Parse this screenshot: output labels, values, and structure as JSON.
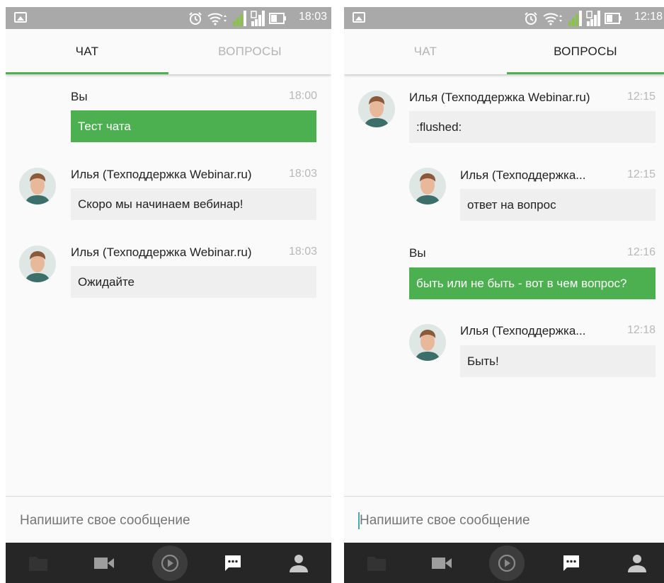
{
  "colors": {
    "accent": "#4caf50",
    "statusbar": "#a9a9a9",
    "navbar": "#262626",
    "bubble_other": "#efefef"
  },
  "left": {
    "status_time": "18:03",
    "tabs": [
      {
        "label": "ЧАТ",
        "active": true
      },
      {
        "label": "ВОПРОСЫ",
        "active": false
      }
    ],
    "messages": [
      {
        "sender": "Вы",
        "time": "18:00",
        "text": "Тест чата",
        "own": true
      },
      {
        "sender": "Илья (Техподдержка Webinar.ru)",
        "time": "18:03",
        "text": "Скоро мы начинаем вебинар!",
        "own": false
      },
      {
        "sender": "Илья (Техподдержка Webinar.ru)",
        "time": "18:03",
        "text": "Ожидайте",
        "own": false
      }
    ],
    "input_placeholder": "Напишите свое сообщение"
  },
  "right": {
    "status_time": "12:18",
    "tabs": [
      {
        "label": "ЧАТ",
        "active": false
      },
      {
        "label": "ВОПРОСЫ",
        "active": true
      }
    ],
    "messages": [
      {
        "sender": "Илья (Техподдержка Webinar.ru)",
        "time": "12:15",
        "text": ":flushed:",
        "own": false
      },
      {
        "sender": "Илья (Техподдержка...",
        "time": "12:15",
        "text": "ответ на вопрос",
        "own": false
      },
      {
        "sender": "Вы",
        "time": "12:16",
        "text": "быть или не быть - вот в чем вопрос?",
        "own": true
      },
      {
        "sender": "Илья (Техподдержка...",
        "time": "12:18",
        "text": "Быть!",
        "own": false
      }
    ],
    "input_placeholder": "Напишите свое сообщение"
  },
  "navbar_icons": [
    "folder-icon",
    "video-camera-icon",
    "play-icon",
    "chat-icon",
    "user-icon"
  ]
}
